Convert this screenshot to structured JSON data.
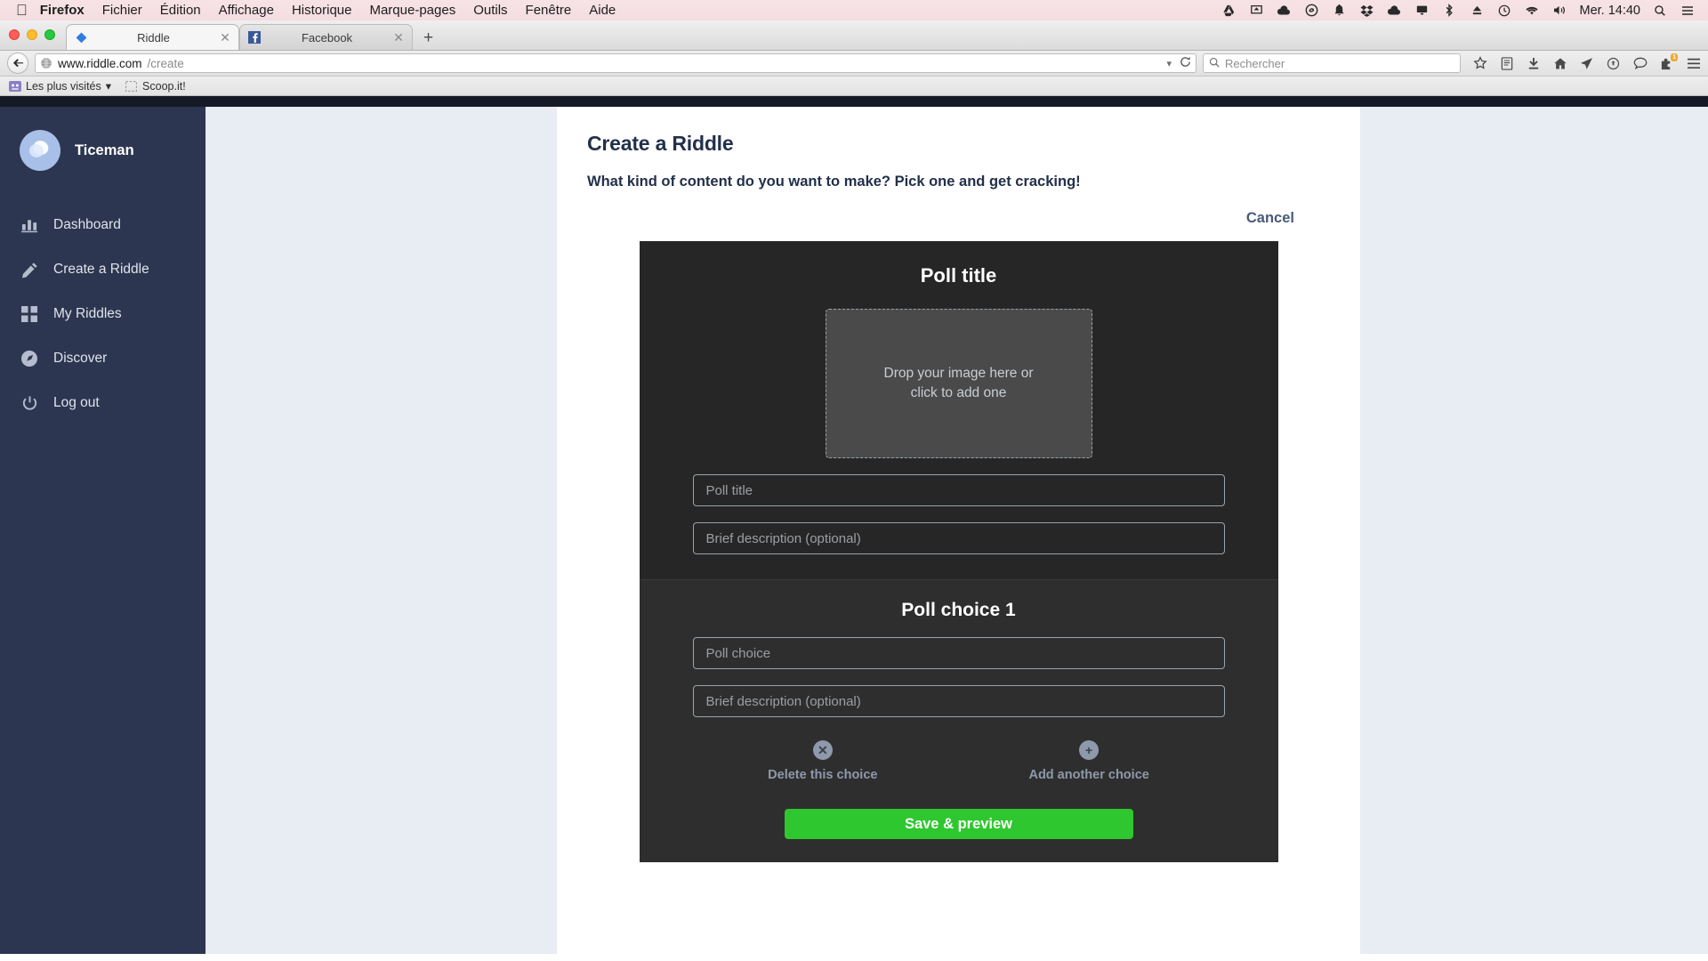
{
  "os_menubar": {
    "apple_icon": "apple-logo",
    "items": [
      {
        "label": "Firefox",
        "bold": true
      },
      {
        "label": "Fichier",
        "bold": false
      },
      {
        "label": "Édition",
        "bold": false
      },
      {
        "label": "Affichage",
        "bold": false
      },
      {
        "label": "Historique",
        "bold": false
      },
      {
        "label": "Marque-pages",
        "bold": false
      },
      {
        "label": "Outils",
        "bold": false
      },
      {
        "label": "Fenêtre",
        "bold": false
      },
      {
        "label": "Aide",
        "bold": false
      }
    ],
    "status_icons": [
      "google-drive-icon",
      "airplay-icon",
      "cloud-icon",
      "creative-cloud-icon",
      "bell-icon",
      "dropbox-icon",
      "cloud-sync-icon",
      "display-icon",
      "bluetooth-icon",
      "eject-icon",
      "time-machine-icon",
      "wifi-icon",
      "volume-icon"
    ],
    "clock": "Mer. 14:40",
    "search_icon": "spotlight-search-icon",
    "menu_icon": "notification-center-icon"
  },
  "browser": {
    "window_controls": [
      "close-button",
      "minimize-button",
      "zoom-button"
    ],
    "tabs": [
      {
        "title": "Riddle",
        "favicon": "riddle-diamond-favicon",
        "active": true,
        "close_label": "✕"
      },
      {
        "title": "Facebook",
        "favicon": "facebook-favicon",
        "active": false,
        "close_label": "✕"
      }
    ],
    "new_tab_label": "+",
    "back_button_icon": "back-arrow-icon",
    "address": {
      "icon": "globe-icon",
      "url_strong": "www.riddle.com",
      "url_dim": "/create",
      "dropdown_icon": "chevron-down-icon",
      "reload_icon": "reload-icon"
    },
    "search": {
      "icon": "search-icon",
      "placeholder": "Rechercher",
      "value": ""
    },
    "toolbar_icons": [
      "bookmark-star-icon",
      "reader-icon",
      "download-icon",
      "home-icon",
      "pocket-icon",
      "sync-icon",
      "chat-icon",
      "addon-icon",
      "hamburger-menu-icon"
    ],
    "addon_badge": "1",
    "bookmarks": [
      {
        "label": "Les plus visités",
        "icon": "folder-icon",
        "has_caret": true
      },
      {
        "label": "Scoop.it!",
        "icon": "bookmark-icon",
        "has_caret": false
      }
    ]
  },
  "sidebar": {
    "avatar_icon": "riddle-logo-avatar",
    "username": "Ticeman",
    "items": [
      {
        "label": "Dashboard",
        "icon": "bar-chart-icon"
      },
      {
        "label": "Create a Riddle",
        "icon": "pencil-icon"
      },
      {
        "label": "My Riddles",
        "icon": "grid-icon"
      },
      {
        "label": "Discover",
        "icon": "compass-icon"
      },
      {
        "label": "Log out",
        "icon": "power-icon"
      }
    ]
  },
  "main": {
    "title": "Create a Riddle",
    "subtitle": "What kind of content do you want to make? Pick one and get cracking!",
    "cancel_label": "Cancel",
    "poll": {
      "section_title": "Poll title",
      "dropzone_line1": "Drop your image here or",
      "dropzone_line2": "click to add one",
      "title_input": {
        "placeholder": "Poll title",
        "value": ""
      },
      "description_input": {
        "placeholder": "Brief description (optional)",
        "value": ""
      },
      "choice": {
        "heading": "Poll choice 1",
        "choice_input": {
          "placeholder": "Poll choice",
          "value": ""
        },
        "description_input": {
          "placeholder": "Brief description (optional)",
          "value": ""
        },
        "delete_label": "Delete this choice",
        "delete_icon": "circle-x-icon",
        "add_label": "Add another choice",
        "add_icon": "circle-plus-icon"
      },
      "save_label": "Save & preview"
    }
  },
  "colors": {
    "sidebar_bg": "#2c3650",
    "card_bg": "#262626",
    "card_mid_bg": "#2e2e2e",
    "save_green": "#2fc72f",
    "page_bg": "#e8ecf3",
    "heading": "#23304a"
  }
}
